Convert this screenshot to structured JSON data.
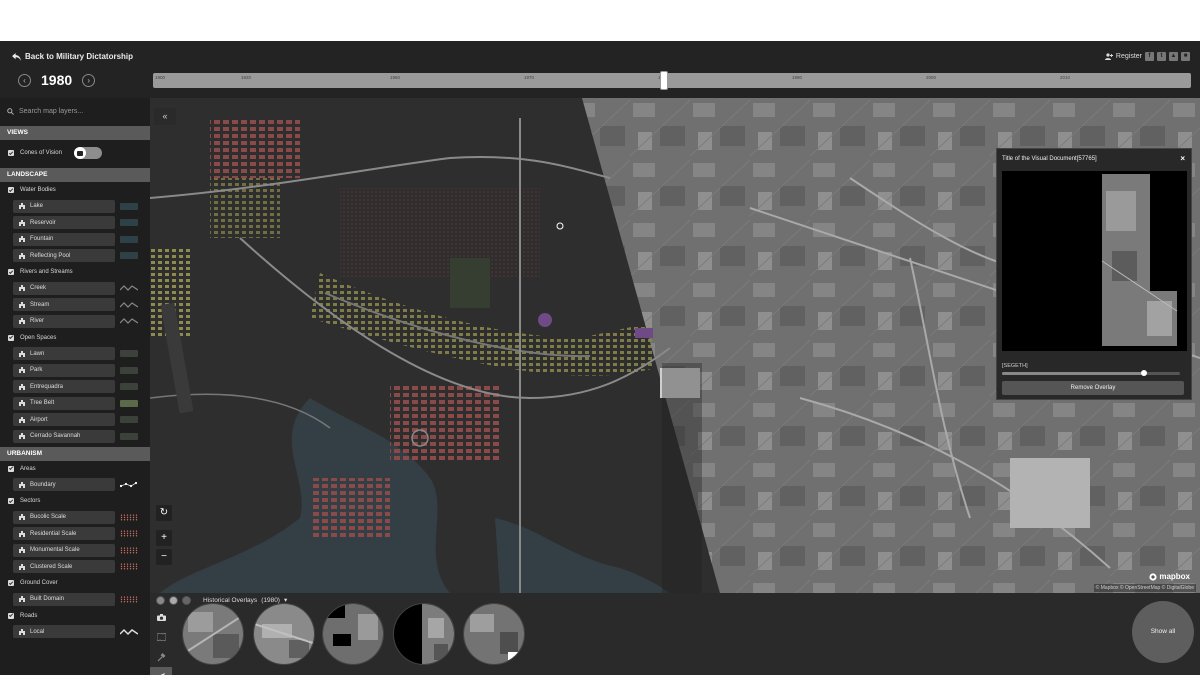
{
  "header": {
    "back_label": "Back to Military Dictatorship",
    "year": "1980",
    "register_label": "Register",
    "socials": [
      "f",
      "t",
      "▲",
      "■"
    ]
  },
  "timeline": {
    "ticks": [
      "1900",
      "1920",
      "1960",
      "1970",
      "1980",
      "1990",
      "2000",
      "2010"
    ]
  },
  "sidebar": {
    "search_placeholder": "Search map layers...",
    "sections": [
      {
        "title": "VIEWS",
        "groups": [
          {
            "label": "Cones of Vision",
            "toggle": true,
            "items": []
          }
        ]
      },
      {
        "title": "LANDSCAPE",
        "groups": [
          {
            "label": "Water Bodies",
            "items": [
              {
                "label": "Lake",
                "swatch": "#2e4147"
              },
              {
                "label": "Reservoir",
                "swatch": "#2e4147"
              },
              {
                "label": "Fountain",
                "swatch": "#2e4147"
              },
              {
                "label": "Reflecting Pool",
                "swatch": "#2e4147"
              }
            ]
          },
          {
            "label": "Rivers and Streams",
            "items": [
              {
                "label": "Creek",
                "swatch": "wave"
              },
              {
                "label": "Stream",
                "swatch": "wave"
              },
              {
                "label": "River",
                "swatch": "wave"
              }
            ]
          },
          {
            "label": "Open Spaces",
            "items": [
              {
                "label": "Lawn",
                "swatch": "#3c413c"
              },
              {
                "label": "Park",
                "swatch": "#3c413c"
              },
              {
                "label": "Entrequadra",
                "swatch": "#3c413c"
              },
              {
                "label": "Tree Belt",
                "swatch": "#5a6a4a"
              },
              {
                "label": "Airport",
                "swatch": "#3c413c"
              },
              {
                "label": "Cerrado Savannah",
                "swatch": "#3c413c"
              }
            ]
          }
        ]
      },
      {
        "title": "URBANISM",
        "groups": [
          {
            "label": "Areas",
            "items": [
              {
                "label": "Boundary",
                "swatch": "boundary"
              }
            ]
          },
          {
            "label": "Sectors",
            "items": [
              {
                "label": "Bucolic Scale",
                "swatch": "dots"
              },
              {
                "label": "Residential Scale",
                "swatch": "dots"
              },
              {
                "label": "Monumental Scale",
                "swatch": "dots"
              },
              {
                "label": "Clustered Scale",
                "swatch": "dots"
              }
            ]
          },
          {
            "label": "Ground Cover",
            "items": [
              {
                "label": "Built Domain",
                "swatch": "dots"
              }
            ]
          },
          {
            "label": "Roads",
            "items": [
              {
                "label": "Local",
                "swatch": "wave-bold"
              }
            ]
          }
        ]
      }
    ]
  },
  "map": {
    "mapbox_label": "mapbox",
    "attribution": "© Mapbox © OpenStreetMap © DigitalGlobe"
  },
  "doc_panel": {
    "title": "Title of the Visual Document[57765]",
    "close_label": "×",
    "layer_label": "[SEGETH]",
    "opacity": 0.8,
    "remove_label": "Remove Overlay"
  },
  "overlays": {
    "label": "Historical Overlays",
    "year": "(1980)",
    "show_all_label": "Show all",
    "thumbnail_count": 5
  }
}
